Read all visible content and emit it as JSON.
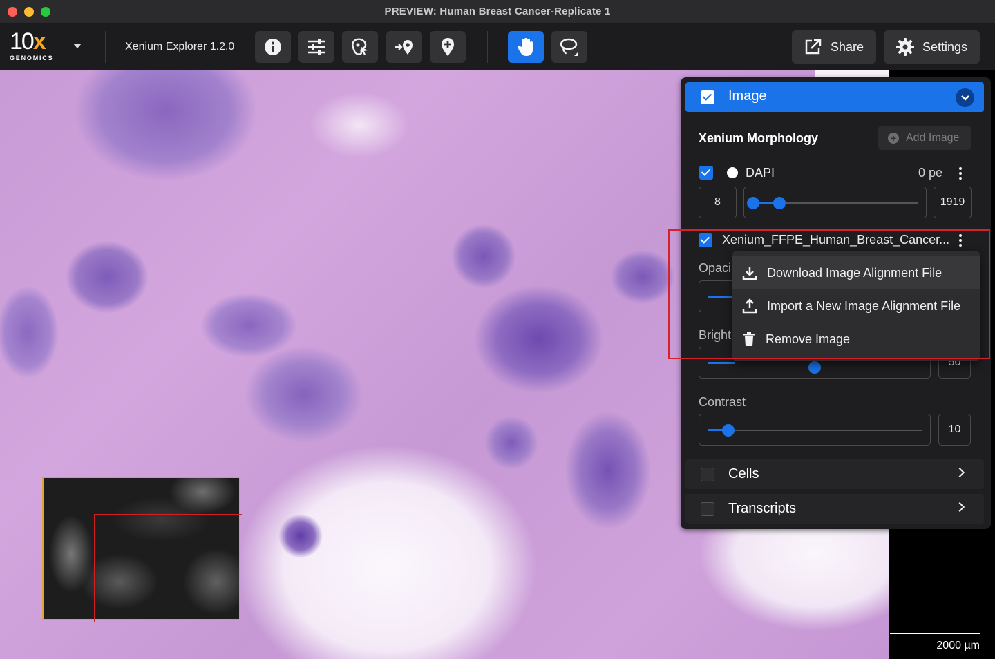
{
  "window": {
    "title": "PREVIEW: Human Breast Cancer-Replicate 1"
  },
  "toolbar": {
    "logo_main": "10",
    "logo_x": "x",
    "logo_sub": "GENOMICS",
    "app_version": "Xenium Explorer 1.2.0",
    "share_label": "Share",
    "settings_label": "Settings",
    "icons": [
      "info-icon",
      "sliders-icon",
      "cell-select-icon",
      "move-pin-icon",
      "add-pin-icon",
      "hand-pan-icon",
      "lasso-icon"
    ]
  },
  "panel": {
    "header_title": "Image",
    "section_title": "Xenium Morphology",
    "add_image_label": "Add Image",
    "dapi": {
      "label": "DAPI",
      "value_label": "0 pe",
      "min": "8",
      "max": "1919"
    },
    "he_image": {
      "label": "Xenium_FFPE_Human_Breast_Cancer...",
      "opacity_label": "Opaci",
      "brightness_label": "Bright",
      "brightness_value": "50"
    },
    "contrast": {
      "label": "Contrast",
      "value": "10"
    },
    "cells_label": "Cells",
    "transcripts_label": "Transcripts"
  },
  "context_menu": {
    "items": [
      {
        "label": "Download Image Alignment File",
        "icon": "download-icon"
      },
      {
        "label": "Import a New Image Alignment File",
        "icon": "upload-icon"
      },
      {
        "label": "Remove Image",
        "icon": "trash-icon"
      }
    ]
  },
  "map": {
    "scale_label": "2000  µm"
  },
  "colors": {
    "accent": "#1a73e8",
    "highlight": "#d6202a",
    "minimap_border": "#e0a23a"
  }
}
